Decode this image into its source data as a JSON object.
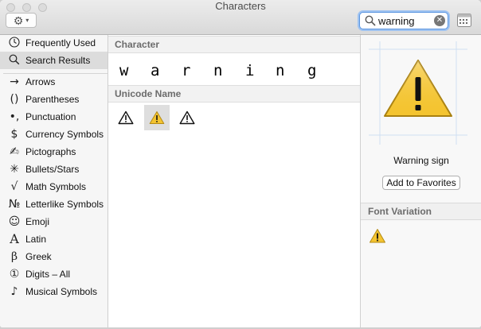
{
  "window": {
    "title": "Characters"
  },
  "toolbar": {
    "gear_menu": "gear-icon",
    "search": {
      "value": "warning",
      "placeholder": "Search"
    }
  },
  "sidebar": {
    "top_items": [
      {
        "label": "Frequently Used",
        "icon": "☐",
        "selected": false
      },
      {
        "label": "Search Results",
        "icon": "⌕",
        "selected": true
      }
    ],
    "categories": [
      {
        "label": "Arrows",
        "icon": "→"
      },
      {
        "label": "Parentheses",
        "icon": "()"
      },
      {
        "label": "Punctuation",
        "icon": "•,"
      },
      {
        "label": "Currency Symbols",
        "icon": "$"
      },
      {
        "label": "Pictographs",
        "icon": "✍"
      },
      {
        "label": "Bullets/Stars",
        "icon": "✳"
      },
      {
        "label": "Math Symbols",
        "icon": "√"
      },
      {
        "label": "Letterlike Symbols",
        "icon": "№"
      },
      {
        "label": "Emoji",
        "icon": "☺"
      },
      {
        "label": "Latin",
        "icon": "A"
      },
      {
        "label": "Greek",
        "icon": "β"
      },
      {
        "label": "Digits – All",
        "icon": "①"
      },
      {
        "label": "Musical Symbols",
        "icon": "♪"
      }
    ]
  },
  "results": {
    "character_header": "Character",
    "character_letters": [
      "w",
      "a",
      "r",
      "n",
      "i",
      "n",
      "g"
    ],
    "unicode_header": "Unicode Name",
    "glyphs": [
      {
        "name": "warning-sign-text",
        "selected": false
      },
      {
        "name": "warning-sign-emoji",
        "selected": true
      },
      {
        "name": "warning-sign-text-alt",
        "selected": false
      }
    ]
  },
  "inspector": {
    "character_name": "Warning sign",
    "add_to_favorites": "Add to Favorites",
    "font_variation_header": "Font Variation"
  },
  "colors": {
    "warning_yellow": "#f4c430",
    "selection_gray": "#dcdcdc",
    "search_focus": "#5b95e0"
  }
}
